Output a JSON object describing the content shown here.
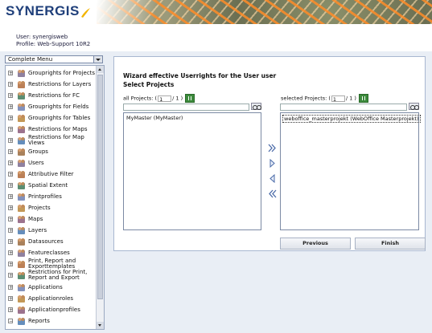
{
  "header": {
    "logo": "SYNERGIS",
    "user_line": "User: synergisweb",
    "profile_line": "Profile: Web-Support 10R2",
    "brand_color": "#1f3f7a",
    "accent_color": "#f2b400"
  },
  "menu": {
    "selected": "Complete Menu",
    "items": [
      {
        "label": "Grouprights for Projects",
        "icon": "group-rights-icon",
        "expand": "+"
      },
      {
        "label": "Restrictions for Layers",
        "icon": "restriction-icon",
        "expand": "+"
      },
      {
        "label": "Restrictions for FC",
        "icon": "restriction-fc-icon",
        "expand": "+"
      },
      {
        "label": "Grouprights for Fields",
        "icon": "group-rights-icon",
        "expand": "+"
      },
      {
        "label": "Grouprights for Tables",
        "icon": "group-rights-icon",
        "expand": "+"
      },
      {
        "label": "Restrictions for Maps",
        "icon": "restriction-maps-icon",
        "expand": "+"
      },
      {
        "label": "Restrictions for Map Views",
        "icon": "restriction-mapviews-icon",
        "expand": "+"
      },
      {
        "label": "Groups",
        "icon": "groups-icon",
        "expand": "+"
      },
      {
        "label": "Users",
        "icon": "users-icon",
        "expand": "+"
      },
      {
        "label": "Attributive Filter",
        "icon": "filter-icon",
        "expand": "+"
      },
      {
        "label": "Spatial Extent",
        "icon": "spatial-extent-icon",
        "expand": "+"
      },
      {
        "label": "Printprofiles",
        "icon": "print-icon",
        "expand": "+"
      },
      {
        "label": "Projects",
        "icon": "projects-icon",
        "expand": "+"
      },
      {
        "label": "Maps",
        "icon": "maps-icon",
        "expand": "+"
      },
      {
        "label": "Layers",
        "icon": "layers-icon",
        "expand": "+"
      },
      {
        "label": "Datasources",
        "icon": "datasources-icon",
        "expand": "+"
      },
      {
        "label": "Featureclasses",
        "icon": "featureclasses-icon",
        "expand": "+"
      },
      {
        "label": "Print, Report and Exporttemplates",
        "icon": "templates-icon",
        "expand": "+"
      },
      {
        "label": "Restrictions for Print, Report and Export",
        "icon": "restriction-print-icon",
        "expand": "+"
      },
      {
        "label": "Applications",
        "icon": "applications-icon",
        "expand": "+"
      },
      {
        "label": "Applicationroles",
        "icon": "approles-icon",
        "expand": "+"
      },
      {
        "label": "Applicationprofiles",
        "icon": "appprofiles-icon",
        "expand": "+"
      },
      {
        "label": "Reports",
        "icon": "reports-icon",
        "expand": "−"
      }
    ]
  },
  "wizard": {
    "title": "Wizard effective Userrights for the User user",
    "subtitle": "Select Projects",
    "all": {
      "label": "all Projects: (",
      "page": "1",
      "sep": "/",
      "total": "1",
      "close": ")"
    },
    "selected": {
      "label": "selected Projects: (",
      "page": "1",
      "sep": "/",
      "total": "1",
      "close": ")"
    },
    "all_items": [
      "MyMaster (MyMaster)"
    ],
    "selected_items": [
      "weboffice_masterprojekt (WebOffice Masterprojekt)"
    ],
    "previous_label": "Previous",
    "finish_label": "Finish"
  }
}
